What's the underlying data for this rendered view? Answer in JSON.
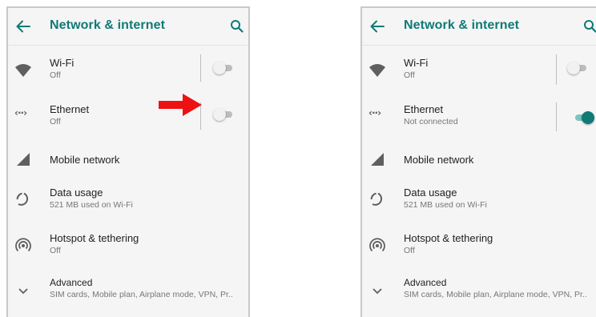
{
  "colors": {
    "accent": "#0f7a76",
    "screen_bg": "#f5f5f5",
    "arrow": "#ee1111",
    "toggle_on": "#0f7a76",
    "toggle_off": "#bdbdbd"
  },
  "left_screen": {
    "header": {
      "title": "Network & internet",
      "back_icon": "arrow-left-icon",
      "search_icon": "search-icon"
    },
    "wifi": {
      "title": "Wi-Fi",
      "status": "Off",
      "toggle": "off"
    },
    "ethernet": {
      "title": "Ethernet",
      "status": "Off",
      "toggle": "off"
    },
    "mobile_network": {
      "title": "Mobile network"
    },
    "data_usage": {
      "title": "Data usage",
      "status": "521 MB used on Wi-Fi"
    },
    "hotspot": {
      "title": "Hotspot & tethering",
      "status": "Off"
    },
    "advanced": {
      "title": "Advanced",
      "status": "SIM cards, Mobile plan, Airplane mode, VPN, Pr.."
    },
    "annotation": "red-arrow-pointing-at-ethernet-toggle"
  },
  "right_screen": {
    "header": {
      "title": "Network & internet",
      "back_icon": "arrow-left-icon",
      "search_icon": "search-icon"
    },
    "wifi": {
      "title": "Wi-Fi",
      "status": "Off",
      "toggle": "off"
    },
    "ethernet": {
      "title": "Ethernet",
      "status": "Not connected",
      "toggle": "on"
    },
    "mobile_network": {
      "title": "Mobile network"
    },
    "data_usage": {
      "title": "Data usage",
      "status": "521 MB used on Wi-Fi"
    },
    "hotspot": {
      "title": "Hotspot & tethering",
      "status": "Off"
    },
    "advanced": {
      "title": "Advanced",
      "status": "SIM cards, Mobile plan, Airplane mode, VPN, Pr.."
    }
  }
}
